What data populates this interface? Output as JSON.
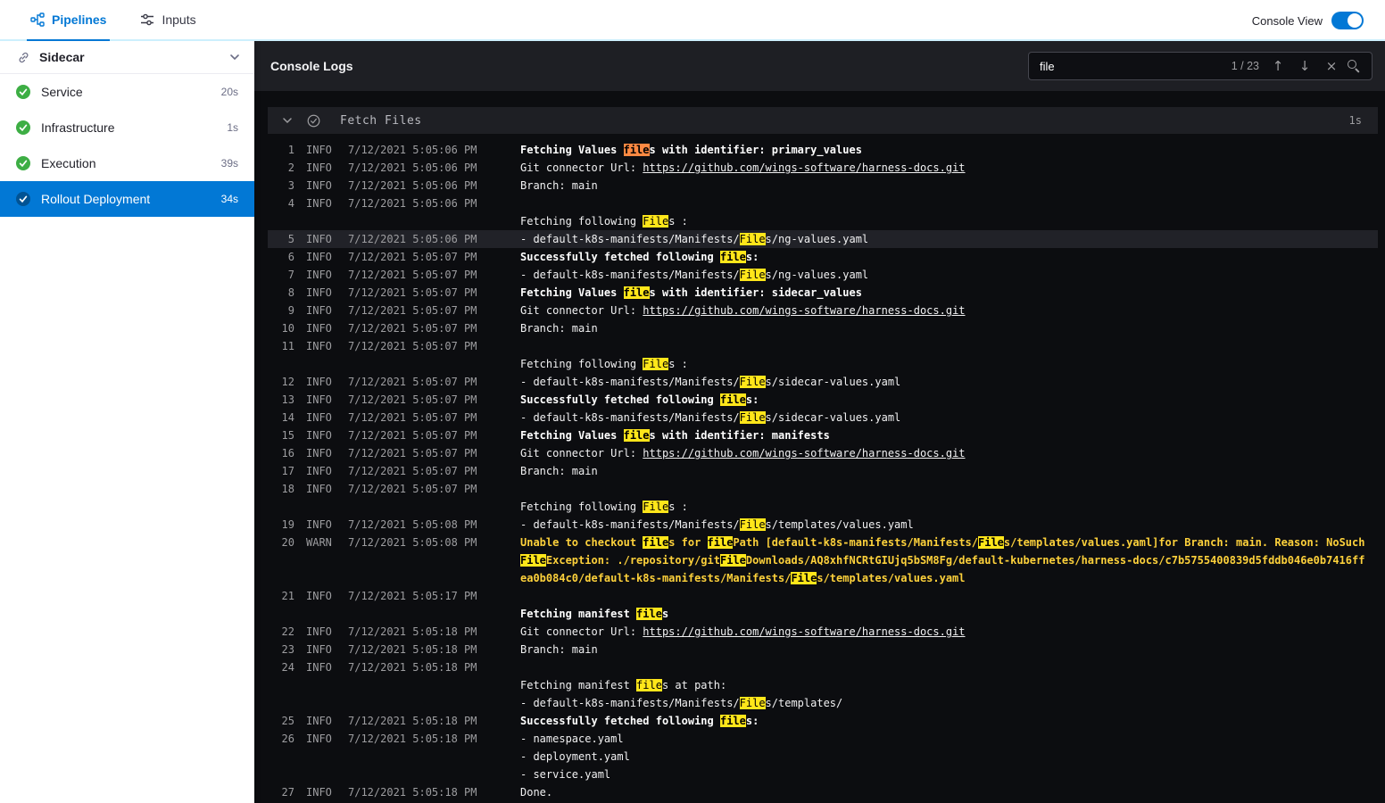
{
  "topbar": {
    "tabs": [
      {
        "label": "Pipelines"
      },
      {
        "label": "Inputs"
      }
    ],
    "console_view_label": "Console View",
    "console_view_on": true
  },
  "icons": {
    "previous_match": "↑",
    "next_match": "↓",
    "clear": "×"
  },
  "sidebar": {
    "title": "Sidecar",
    "items": [
      {
        "label": "Service",
        "duration": "20s",
        "status": "success",
        "selected": false
      },
      {
        "label": "Infrastructure",
        "duration": "1s",
        "status": "success",
        "selected": false
      },
      {
        "label": "Execution",
        "duration": "39s",
        "status": "success",
        "selected": false
      },
      {
        "label": "Rollout Deployment",
        "duration": "34s",
        "status": "success",
        "selected": true
      }
    ]
  },
  "console": {
    "title": "Console Logs",
    "search": {
      "value": "file",
      "match_counter": "1 / 23"
    },
    "section": {
      "title": "Fetch Files",
      "duration": "1s",
      "status": "success"
    },
    "logs": [
      {
        "num": 1,
        "level": "INFO",
        "time": "7/12/2021 5:05:06 PM",
        "lines": [
          {
            "bold": true,
            "parts": [
              {
                "text": "Fetching Values files with identifier: primary_values"
              }
            ]
          }
        ]
      },
      {
        "num": 2,
        "level": "INFO",
        "time": "7/12/2021 5:05:06 PM",
        "lines": [
          {
            "parts": [
              {
                "text": "Git connector Url: "
              },
              {
                "text": "https://github.com/wings-software/harness-docs.git",
                "link": true
              }
            ]
          }
        ]
      },
      {
        "num": 3,
        "level": "INFO",
        "time": "7/12/2021 5:05:06 PM",
        "lines": [
          {
            "parts": [
              {
                "text": "Branch: main"
              }
            ]
          }
        ]
      },
      {
        "num": 4,
        "level": "INFO",
        "time": "7/12/2021 5:05:06 PM",
        "lines": [
          {
            "parts": []
          },
          {
            "parts": [
              {
                "text": "Fetching following Files :"
              }
            ]
          }
        ]
      },
      {
        "num": 5,
        "level": "INFO",
        "time": "7/12/2021 5:05:06 PM",
        "highlighted": true,
        "lines": [
          {
            "parts": [
              {
                "text": "- default-k8s-manifests/Manifests/Files/ng-values.yaml"
              }
            ]
          }
        ]
      },
      {
        "num": 6,
        "level": "INFO",
        "time": "7/12/2021 5:05:07 PM",
        "lines": [
          {
            "bold": true,
            "parts": [
              {
                "text": "Successfully fetched following files:"
              }
            ]
          }
        ]
      },
      {
        "num": 7,
        "level": "INFO",
        "time": "7/12/2021 5:05:07 PM",
        "lines": [
          {
            "parts": [
              {
                "text": "- default-k8s-manifests/Manifests/Files/ng-values.yaml"
              }
            ]
          }
        ]
      },
      {
        "num": 8,
        "level": "INFO",
        "time": "7/12/2021 5:05:07 PM",
        "lines": [
          {
            "bold": true,
            "parts": [
              {
                "text": "Fetching Values files with identifier: sidecar_values"
              }
            ]
          }
        ]
      },
      {
        "num": 9,
        "level": "INFO",
        "time": "7/12/2021 5:05:07 PM",
        "lines": [
          {
            "parts": [
              {
                "text": "Git connector Url: "
              },
              {
                "text": "https://github.com/wings-software/harness-docs.git",
                "link": true
              }
            ]
          }
        ]
      },
      {
        "num": 10,
        "level": "INFO",
        "time": "7/12/2021 5:05:07 PM",
        "lines": [
          {
            "parts": [
              {
                "text": "Branch: main"
              }
            ]
          }
        ]
      },
      {
        "num": 11,
        "level": "INFO",
        "time": "7/12/2021 5:05:07 PM",
        "lines": [
          {
            "parts": []
          },
          {
            "parts": [
              {
                "text": "Fetching following Files :"
              }
            ]
          }
        ]
      },
      {
        "num": 12,
        "level": "INFO",
        "time": "7/12/2021 5:05:07 PM",
        "lines": [
          {
            "parts": [
              {
                "text": "- default-k8s-manifests/Manifests/Files/sidecar-values.yaml"
              }
            ]
          }
        ]
      },
      {
        "num": 13,
        "level": "INFO",
        "time": "7/12/2021 5:05:07 PM",
        "lines": [
          {
            "bold": true,
            "parts": [
              {
                "text": "Successfully fetched following files:"
              }
            ]
          }
        ]
      },
      {
        "num": 14,
        "level": "INFO",
        "time": "7/12/2021 5:05:07 PM",
        "lines": [
          {
            "parts": [
              {
                "text": "- default-k8s-manifests/Manifests/Files/sidecar-values.yaml"
              }
            ]
          }
        ]
      },
      {
        "num": 15,
        "level": "INFO",
        "time": "7/12/2021 5:05:07 PM",
        "lines": [
          {
            "bold": true,
            "parts": [
              {
                "text": "Fetching Values files with identifier: manifests"
              }
            ]
          }
        ]
      },
      {
        "num": 16,
        "level": "INFO",
        "time": "7/12/2021 5:05:07 PM",
        "lines": [
          {
            "parts": [
              {
                "text": "Git connector Url: "
              },
              {
                "text": "https://github.com/wings-software/harness-docs.git",
                "link": true
              }
            ]
          }
        ]
      },
      {
        "num": 17,
        "level": "INFO",
        "time": "7/12/2021 5:05:07 PM",
        "lines": [
          {
            "parts": [
              {
                "text": "Branch: main"
              }
            ]
          }
        ]
      },
      {
        "num": 18,
        "level": "INFO",
        "time": "7/12/2021 5:05:07 PM",
        "lines": [
          {
            "parts": []
          },
          {
            "parts": [
              {
                "text": "Fetching following Files :"
              }
            ]
          }
        ]
      },
      {
        "num": 19,
        "level": "INFO",
        "time": "7/12/2021 5:05:08 PM",
        "lines": [
          {
            "parts": [
              {
                "text": "- default-k8s-manifests/Manifests/Files/templates/values.yaml"
              }
            ]
          }
        ]
      },
      {
        "num": 20,
        "level": "WARN",
        "time": "7/12/2021 5:05:08 PM",
        "lines": [
          {
            "bold": true,
            "warn": true,
            "parts": [
              {
                "text": "Unable to checkout files for filePath [default-k8s-manifests/Manifests/Files/templates/values.yaml]for Branch: main. Reason: NoSuchFileException: ./repository/gitFileDownloads/AQ8xhfNCRtGIUjq5bSM8Fg/default-kubernetes/harness-docs/c7b5755400839d5fddb046e0b7416ffea0b084c0/default-k8s-manifests/Manifests/Files/templates/values.yaml"
              }
            ]
          }
        ]
      },
      {
        "num": 21,
        "level": "INFO",
        "time": "7/12/2021 5:05:17 PM",
        "lines": [
          {
            "parts": []
          },
          {
            "bold": true,
            "parts": [
              {
                "text": "Fetching manifest files"
              }
            ]
          }
        ]
      },
      {
        "num": 22,
        "level": "INFO",
        "time": "7/12/2021 5:05:18 PM",
        "lines": [
          {
            "parts": [
              {
                "text": "Git connector Url: "
              },
              {
                "text": "https://github.com/wings-software/harness-docs.git",
                "link": true
              }
            ]
          }
        ]
      },
      {
        "num": 23,
        "level": "INFO",
        "time": "7/12/2021 5:05:18 PM",
        "lines": [
          {
            "parts": [
              {
                "text": "Branch: main"
              }
            ]
          }
        ]
      },
      {
        "num": 24,
        "level": "INFO",
        "time": "7/12/2021 5:05:18 PM",
        "lines": [
          {
            "parts": []
          },
          {
            "parts": [
              {
                "text": "Fetching manifest files at path:"
              }
            ]
          },
          {
            "parts": [
              {
                "text": "- default-k8s-manifests/Manifests/Files/templates/"
              }
            ]
          }
        ]
      },
      {
        "num": 25,
        "level": "INFO",
        "time": "7/12/2021 5:05:18 PM",
        "lines": [
          {
            "bold": true,
            "parts": [
              {
                "text": "Successfully fetched following files:"
              }
            ]
          }
        ]
      },
      {
        "num": 26,
        "level": "INFO",
        "time": "7/12/2021 5:05:18 PM",
        "lines": [
          {
            "parts": [
              {
                "text": "- namespace.yaml"
              }
            ]
          },
          {
            "parts": [
              {
                "text": "- deployment.yaml"
              }
            ]
          },
          {
            "parts": [
              {
                "text": "- service.yaml"
              }
            ]
          }
        ]
      },
      {
        "num": 27,
        "level": "INFO",
        "time": "7/12/2021 5:05:18 PM",
        "lines": [
          {
            "parts": [
              {
                "text": "Done."
              }
            ]
          }
        ]
      }
    ]
  },
  "colors": {
    "accent_blue": "#0278d5",
    "success_green": "#3dae44",
    "highlight_yellow": "#ffe61a",
    "current_match_orange": "#ff8942",
    "warn_yellow": "#fdd13b"
  }
}
